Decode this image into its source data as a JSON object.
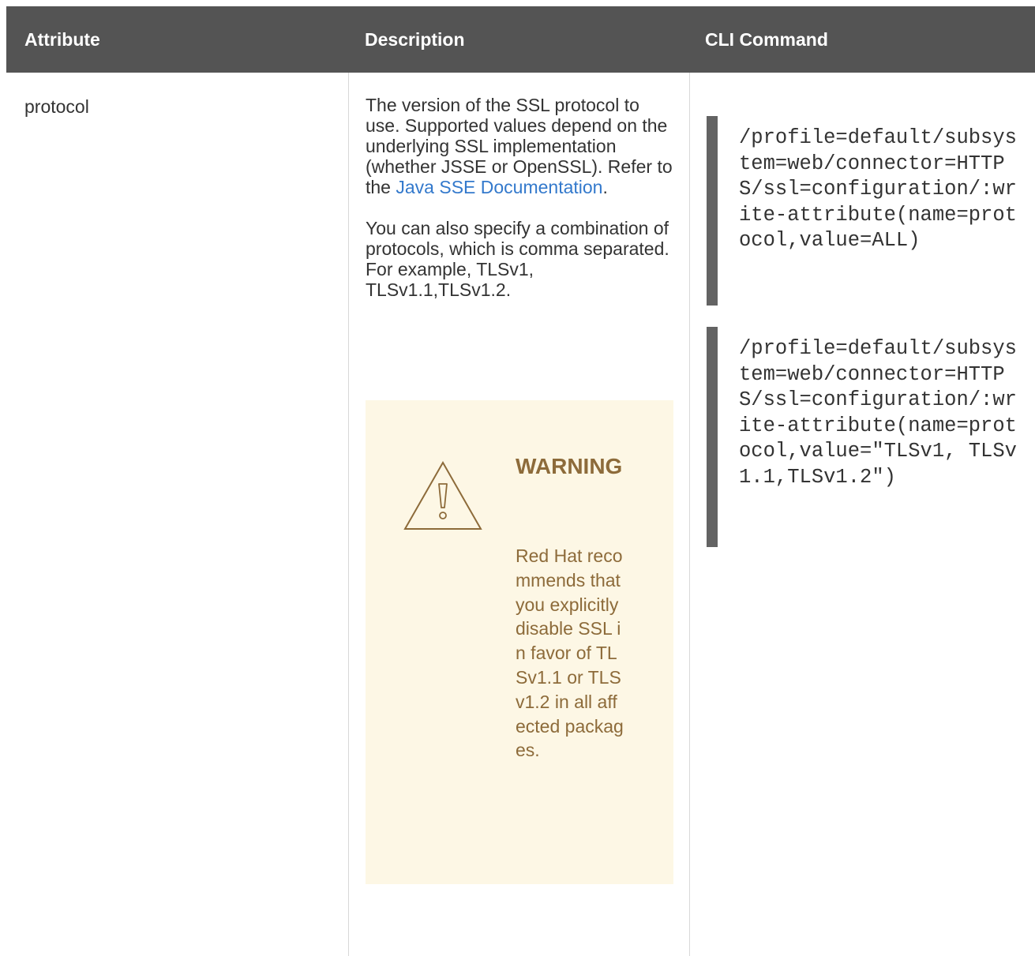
{
  "table": {
    "headers": {
      "attribute": "Attribute",
      "description": "Description",
      "cli": "CLI Command"
    },
    "row": {
      "attribute": "protocol",
      "description": {
        "p1_text": "The version of the SSL protocol to use. Supported values depend on the underlying SSL implementation (whether JSSE or OpenSSL). Refer to the ",
        "link_text": "Java SSE Documentation",
        "p1_end": ".",
        "p2": "You can also specify a combination of protocols, which is comma separated. For example, TLSv1, TLSv1.1,TLSv1.2."
      },
      "warning": {
        "icon": "warning-triangle-icon",
        "title": "WARNING",
        "body": "Red Hat recommends that you explicitly disable SSL in favor of TLSv1.1 or TLSv1.2 in all affected packages."
      },
      "cli": [
        "/profile=default/subsystem=web/connector=HTTPS/ssl=configuration/:write-attribute(name=protocol,value=ALL)",
        "/profile=default/subsystem=web/connector=HTTPS/ssl=configuration/:write-attribute(name=protocol,value=\"TLSv1, TLSv1.1,TLSv1.2\")"
      ]
    }
  },
  "colors": {
    "header_bg": "#545454",
    "link": "#3379cc",
    "warning_bg": "#fdf7e5",
    "warning_text": "#8d6b3a",
    "code_bar": "#636363"
  }
}
